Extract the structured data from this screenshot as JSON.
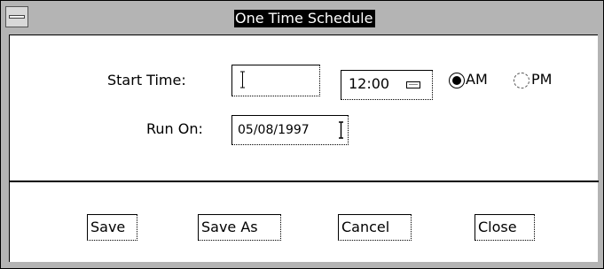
{
  "window": {
    "title": "One Time Schedule"
  },
  "form": {
    "start_time_label": "Start Time:",
    "start_time_value": "",
    "time_value": "12:00",
    "am_label": "AM",
    "pm_label": "PM",
    "selected_period": "AM",
    "run_on_label": "Run On:",
    "run_on_value": "05/08/1997"
  },
  "buttons": {
    "save": "Save",
    "save_as": "Save As",
    "cancel": "Cancel",
    "close": "Close"
  },
  "icons": {
    "window_menu": "window-menu-icon",
    "spinner": "spinner-icon",
    "text_cursor": "text-cursor-icon"
  }
}
